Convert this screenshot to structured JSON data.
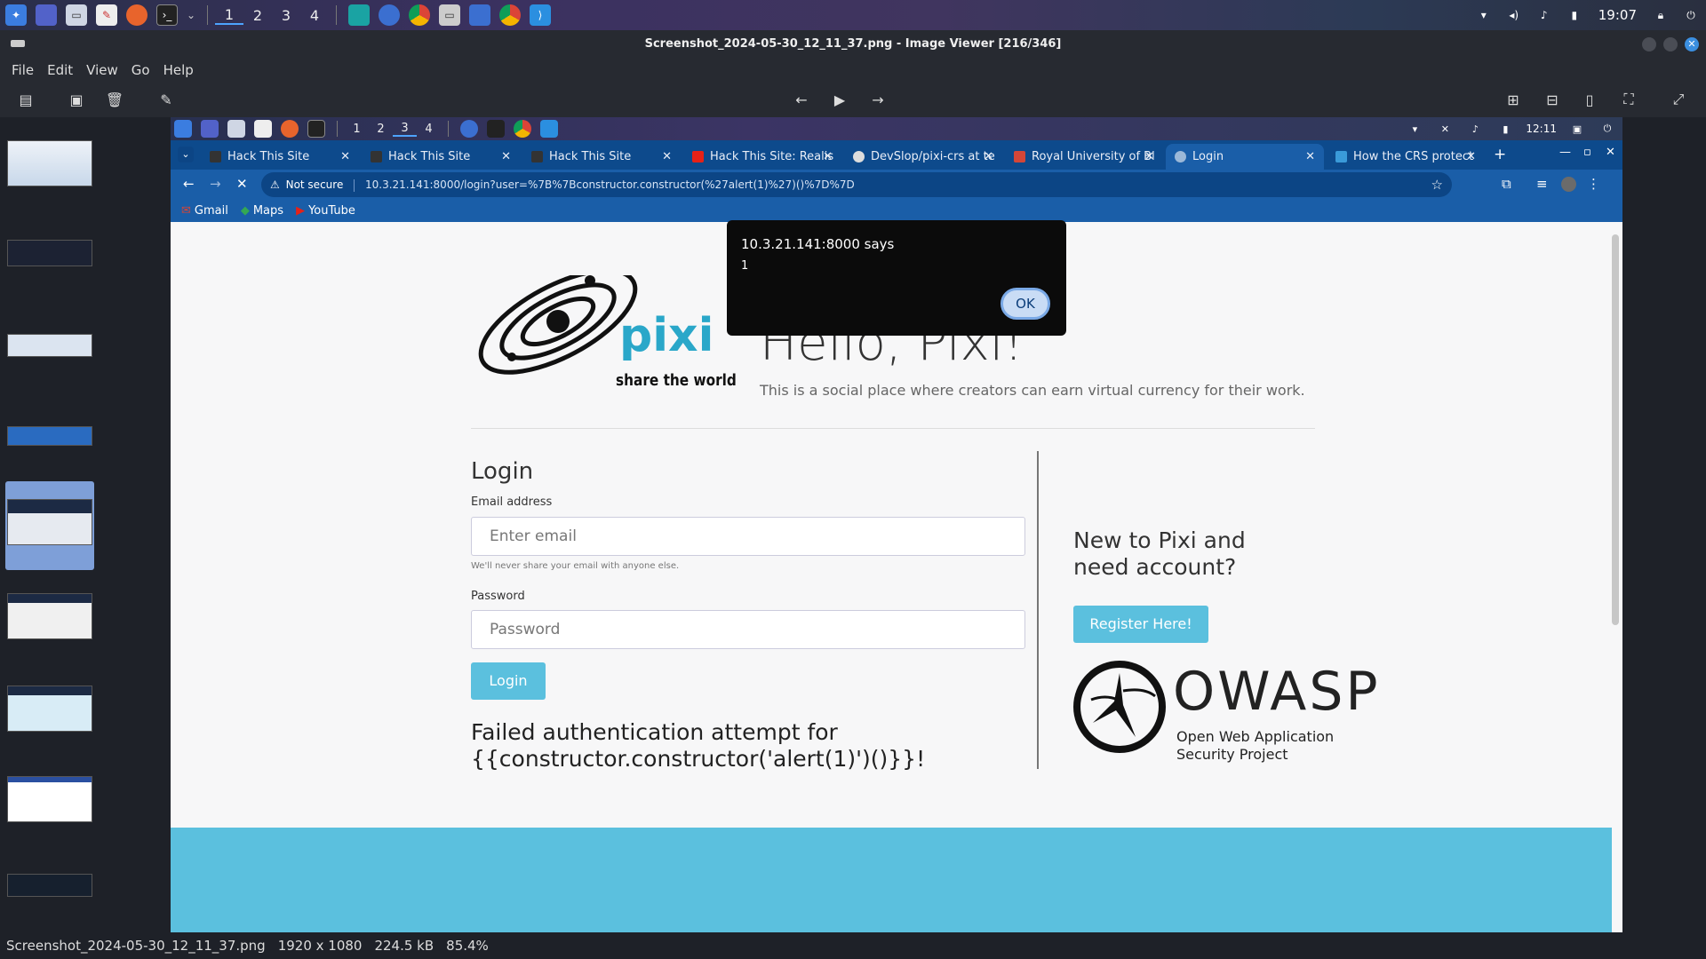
{
  "os": {
    "workspaces": [
      "1",
      "2",
      "3",
      "4"
    ],
    "clock": "19:07"
  },
  "viewer": {
    "title": "Screenshot_2024-05-30_12_11_37.png - Image Viewer [216/346]",
    "menu": [
      "File",
      "Edit",
      "View",
      "Go",
      "Help"
    ],
    "status": {
      "filename": "Screenshot_2024-05-30_12_11_37.png",
      "dimensions": "1920 x 1080",
      "filesize": "224.5 kB",
      "zoom": "85.4%"
    }
  },
  "inner": {
    "workspaces": [
      "1",
      "2",
      "3",
      "4"
    ],
    "clock": "12:11",
    "tabs": [
      {
        "label": "Hack This Site",
        "color": "#333"
      },
      {
        "label": "Hack This Site",
        "color": "#333"
      },
      {
        "label": "Hack This Site",
        "color": "#333"
      },
      {
        "label": "Hack This Site: Realis",
        "color": "#e62117"
      },
      {
        "label": "DevSlop/pixi-crs at te",
        "color": "#222"
      },
      {
        "label": "Royal University of Bl",
        "color": "#d44638"
      },
      {
        "label": "Login",
        "color": "#7ab"
      },
      {
        "label": "How the CRS protect",
        "color": "#3a9ad9"
      }
    ],
    "not_secure": "Not secure",
    "url": "10.3.21.141:8000/login?user=%7B%7Bconstructor.constructor(%27alert(1)%27)()%7D%7D",
    "bookmarks": [
      "Gmail",
      "Maps",
      "YouTube"
    ],
    "dialog": {
      "origin": "10.3.21.141:8000 says",
      "message": "1",
      "ok": "OK"
    },
    "page": {
      "logo_word": "pixi",
      "logo_tagline": "share the world",
      "hero_title": "Hello, Pixi!",
      "hero_sub": "This is a social place where creators can earn virtual currency for their work.",
      "login_title": "Login",
      "email_label": "Email address",
      "email_placeholder": "Enter email",
      "email_help": "We'll never share your email with anyone else.",
      "password_label": "Password",
      "password_placeholder": "Password",
      "login_button": "Login",
      "fail_line1": "Failed authentication attempt for",
      "fail_line2": "{{constructor.constructor('alert(1)')()}}!",
      "new_line1": "New to Pixi and",
      "new_line2": "need account?",
      "register_button": "Register Here!",
      "owasp_word": "OWASP",
      "owasp_line1": "Open Web Application",
      "owasp_line2": "Security Project"
    }
  },
  "colors": {
    "accent_cyan": "#5bc0de",
    "browser_blue": "#1a5ea8"
  }
}
